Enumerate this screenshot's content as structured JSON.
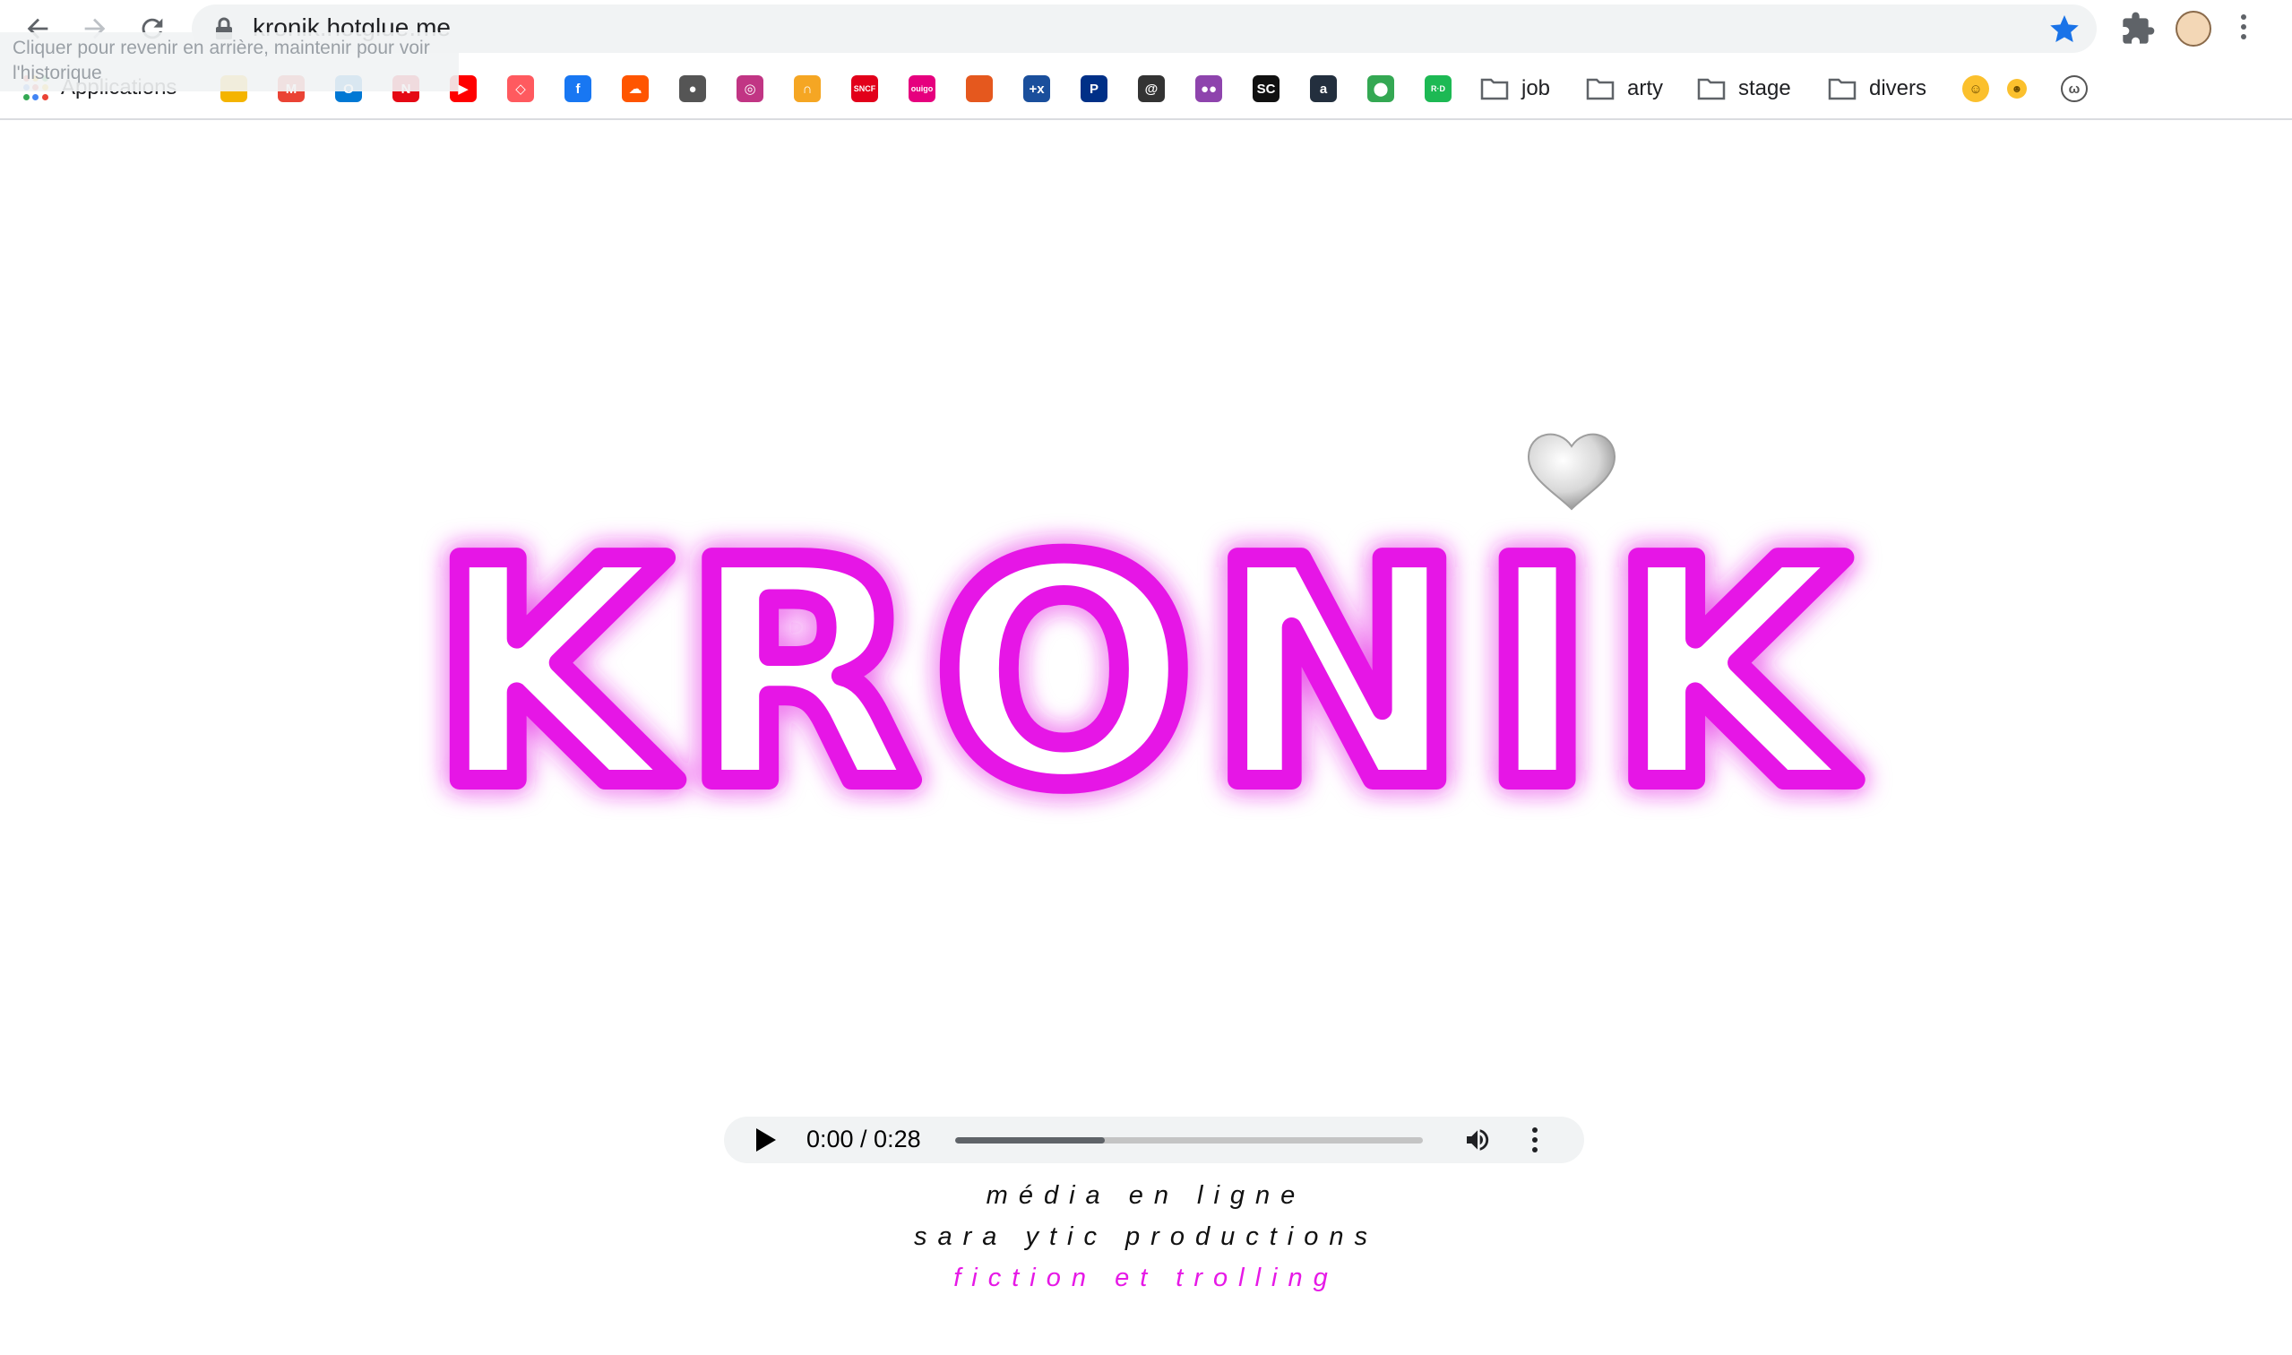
{
  "browser": {
    "url": "kronik.hotglue.me",
    "back_tooltip": "Cliquer pour revenir en arrière, maintenir pour voir l'historique",
    "apps_label": "Applications",
    "folders": [
      "job",
      "arty",
      "stage",
      "divers"
    ]
  },
  "bookmarks": [
    {
      "name": "globe",
      "color": "#f4b400",
      "glyph": ""
    },
    {
      "name": "gmail",
      "color": "#ea4335",
      "glyph": "M"
    },
    {
      "name": "outlook",
      "color": "#0078d4",
      "glyph": "O"
    },
    {
      "name": "netflix",
      "color": "#e50914",
      "glyph": "N"
    },
    {
      "name": "youtube",
      "color": "#ff0000",
      "glyph": "▶"
    },
    {
      "name": "airbnb",
      "color": "#ff5a5f",
      "glyph": "◇"
    },
    {
      "name": "facebook",
      "color": "#1877f2",
      "glyph": "f"
    },
    {
      "name": "soundcloud",
      "color": "#ff5500",
      "glyph": "☁"
    },
    {
      "name": "bird",
      "color": "#555555",
      "glyph": "●"
    },
    {
      "name": "instagram",
      "color": "#c13584",
      "glyph": "◎"
    },
    {
      "name": "headphones",
      "color": "#f5a623",
      "glyph": "∩"
    },
    {
      "name": "sncf",
      "color": "#e2001a",
      "glyph": "SNCF"
    },
    {
      "name": "ouigo",
      "color": "#e6007e",
      "glyph": "ouigo"
    },
    {
      "name": "orange-box",
      "color": "#e5581e",
      "glyph": ""
    },
    {
      "name": "plus-x",
      "color": "#1a4f9c",
      "glyph": "+x"
    },
    {
      "name": "paypal",
      "color": "#003087",
      "glyph": "P"
    },
    {
      "name": "at-sign",
      "color": "#333333",
      "glyph": "@"
    },
    {
      "name": "dots",
      "color": "#8e44ad",
      "glyph": "●●"
    },
    {
      "name": "sc-logo",
      "color": "#111111",
      "glyph": "SC"
    },
    {
      "name": "amazon",
      "color": "#232f3e",
      "glyph": "a"
    },
    {
      "name": "maps",
      "color": "#34a853",
      "glyph": "⬤"
    },
    {
      "name": "red-bookmark",
      "color": "#1db954",
      "glyph": "R·D"
    }
  ],
  "page": {
    "logo_text": "KRONIK",
    "audio": {
      "time": "0:00 / 0:28",
      "progress": 0.32
    },
    "tagline_1": "média en ligne",
    "tagline_2": "sara ytic productions",
    "tagline_3": "fiction et trolling",
    "accent": "#e619e6"
  }
}
